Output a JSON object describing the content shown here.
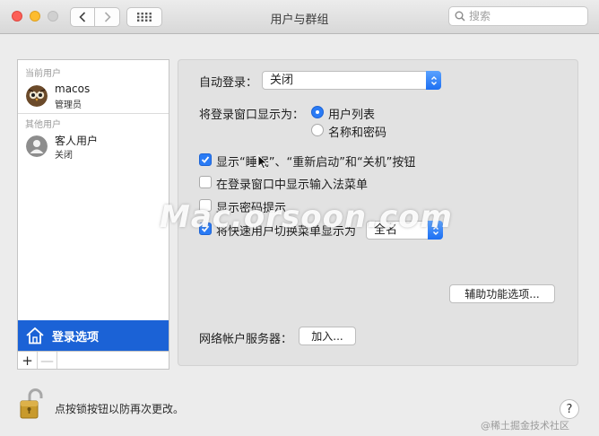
{
  "window": {
    "title": "用户与群组"
  },
  "search": {
    "placeholder": "搜索"
  },
  "sidebar": {
    "current_users_label": "当前用户",
    "current_user": {
      "name": "macos",
      "role": "管理员"
    },
    "other_users_label": "其他用户",
    "guest_user": {
      "name": "客人用户",
      "status": "关闭"
    },
    "login_options_label": "登录选项",
    "add_symbol": "+",
    "remove_symbol": "—"
  },
  "main": {
    "auto_login_label": "自动登录：",
    "auto_login_value": "关闭",
    "login_window_label": "将登录窗口显示为：",
    "login_window_options": [
      "用户列表",
      "名称和密码"
    ],
    "login_window_selected": "用户列表",
    "checkboxes": [
      {
        "label": "显示“睡眠”、“重新启动”和“关机”按钮",
        "checked": true
      },
      {
        "label": "在登录窗口中显示输入法菜单",
        "checked": false
      },
      {
        "label": "显示密码提示",
        "checked": false
      },
      {
        "label": "将快速用户切换菜单显示为",
        "checked": true
      }
    ],
    "fast_switch_value": "全名",
    "accessibility_button": "辅助功能选项...",
    "network_server_label": "网络帐户服务器：",
    "join_button": "加入..."
  },
  "footer": {
    "lock_text": "点按锁按钮以防再次更改。",
    "help_symbol": "?"
  },
  "watermark": "Mac.orsoon.com",
  "credit": "@稀土掘金技术社区",
  "colors": {
    "selection_blue": "#1b62d6",
    "control_blue": "#2a7bf5",
    "close_red": "#fc5f57",
    "minimize_yellow": "#fdbc2e"
  }
}
